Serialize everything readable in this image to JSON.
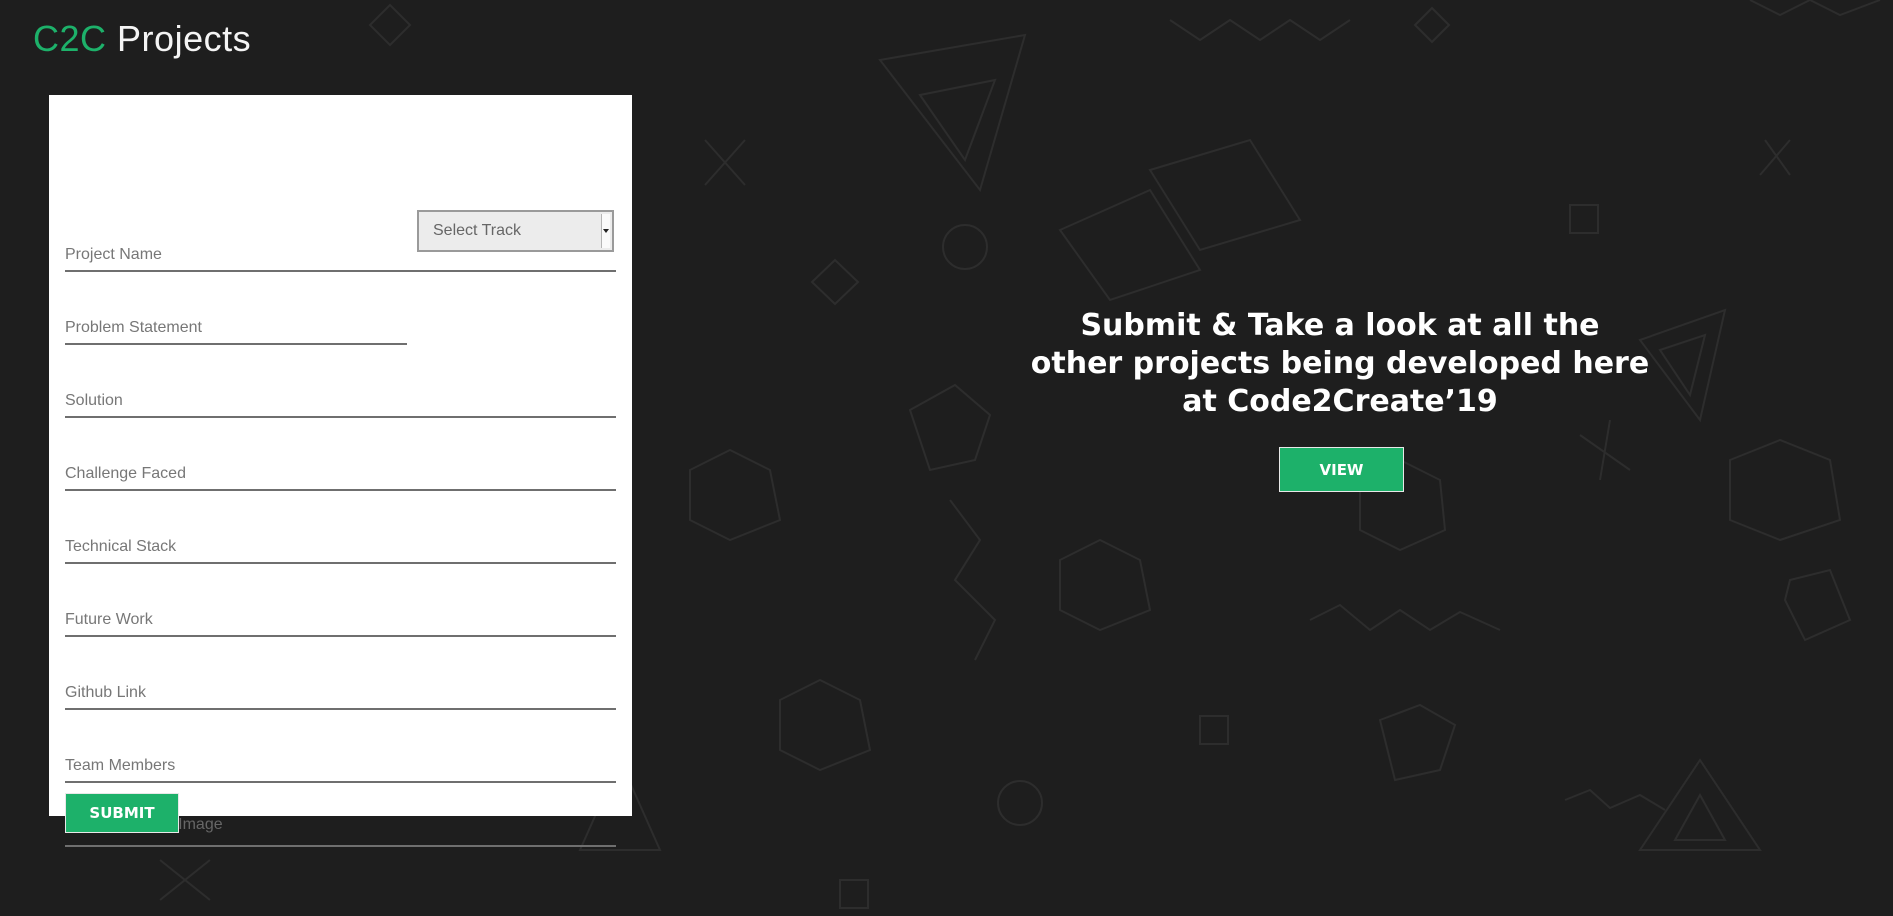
{
  "brand": {
    "accent": "C2C",
    "rest": "Projects"
  },
  "form": {
    "project_name": {
      "placeholder": "Project Name",
      "value": ""
    },
    "problem_statement": {
      "placeholder": "Problem Statement",
      "value": ""
    },
    "track_select": {
      "selected": "Select Track"
    },
    "solution": {
      "placeholder": "Solution",
      "value": ""
    },
    "challenge_faced": {
      "placeholder": "Challenge Faced",
      "value": ""
    },
    "technical_stack": {
      "placeholder": "Technical Stack",
      "value": ""
    },
    "future_work": {
      "placeholder": "Future Work",
      "value": ""
    },
    "github_link": {
      "placeholder": "Github Link",
      "value": ""
    },
    "team_members": {
      "placeholder": "Team Members",
      "value": ""
    },
    "project_image": {
      "label": "Select Project Image"
    },
    "submit_label": "SUBMIT"
  },
  "promo": {
    "line1": "Submit & Take a look at all the",
    "line2": "other projects being developed here",
    "line3": "at Code2Create’19",
    "view_label": "VIEW"
  },
  "colors": {
    "background": "#1e1e1e",
    "accent": "#1db16a",
    "card": "#ffffff"
  }
}
